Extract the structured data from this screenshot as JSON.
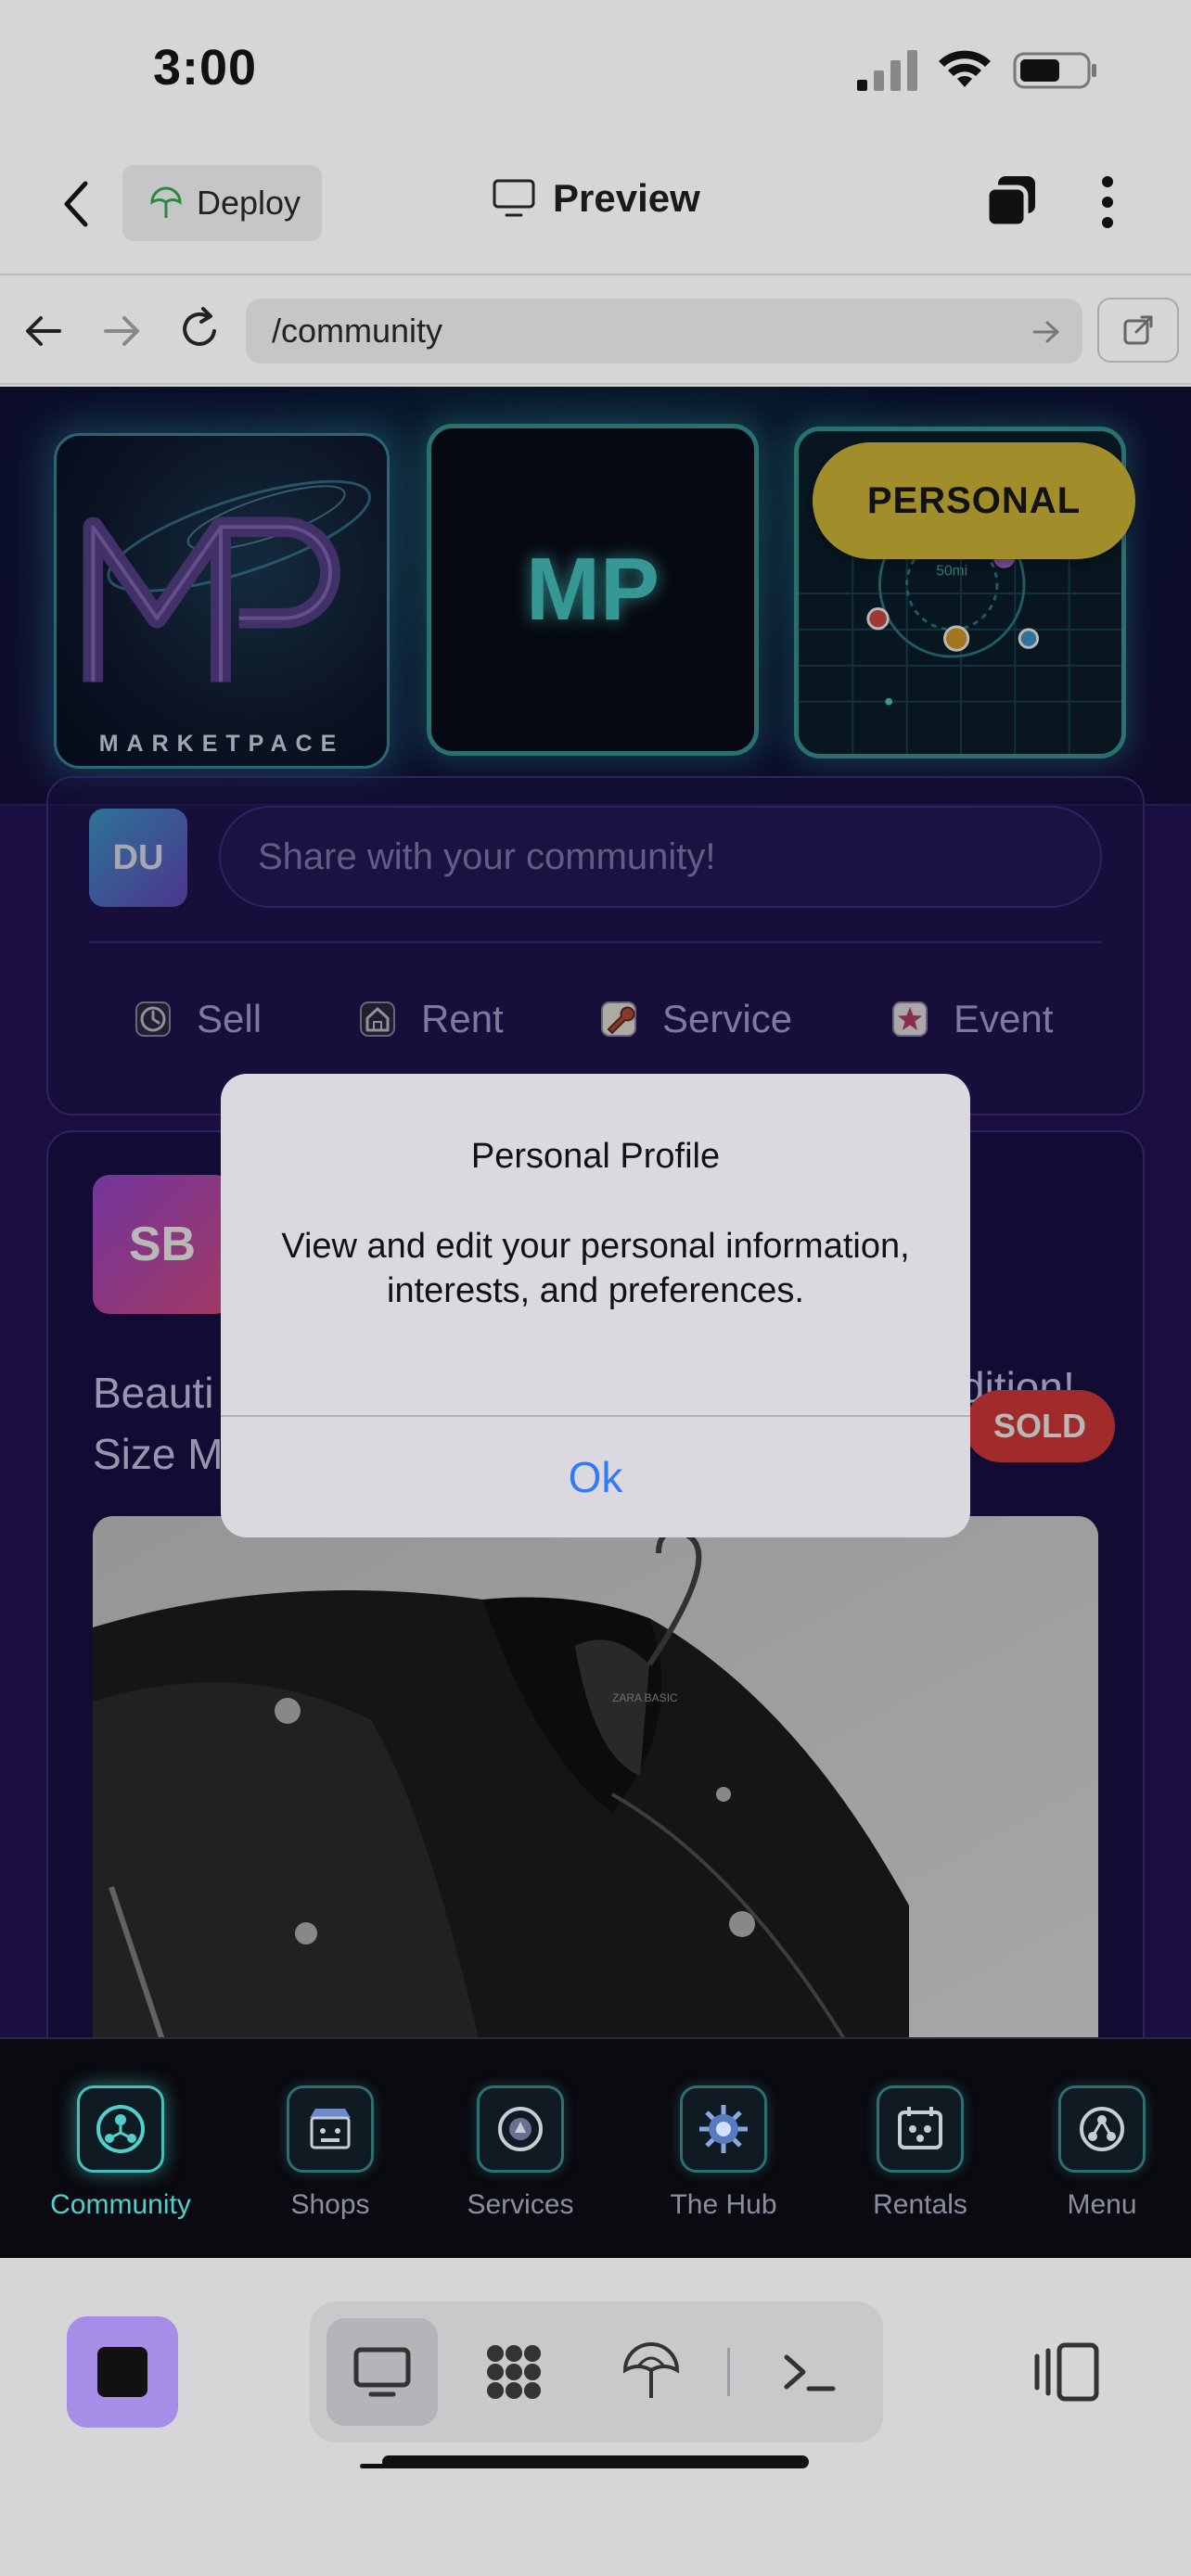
{
  "status_bar": {
    "time": "3:00"
  },
  "header": {
    "deploy_label": "Deploy",
    "title": "Preview"
  },
  "url_bar": {
    "path": "/community"
  },
  "hero": {
    "logo_wordmark": "MARKETPACE",
    "mp_tile_label": "MP",
    "personal_label": "PERSONAL",
    "radar_label": "50mi"
  },
  "composer": {
    "avatar_initials": "DU",
    "placeholder": "Share with your community!",
    "actions": [
      {
        "label": "Sell",
        "icon": "clock-icon"
      },
      {
        "label": "Rent",
        "icon": "house-icon"
      },
      {
        "label": "Service",
        "icon": "wrench-icon"
      },
      {
        "label": "Event",
        "icon": "star-icon"
      }
    ]
  },
  "post": {
    "avatar_initials": "SB",
    "title_line1": "Beauti",
    "title_line2": "Size M",
    "title_right": "dition!",
    "badge": "SOLD",
    "image_label": "ZARA BASIC"
  },
  "alert": {
    "title": "Personal Profile",
    "message": "View and edit your personal information, interests, and preferences.",
    "ok_label": "Ok"
  },
  "app_tabs": [
    {
      "label": "Community",
      "active": true
    },
    {
      "label": "Shops",
      "active": false
    },
    {
      "label": "Services",
      "active": false
    },
    {
      "label": "The Hub",
      "active": false
    },
    {
      "label": "Rentals",
      "active": false
    },
    {
      "label": "Menu",
      "active": false
    }
  ],
  "colors": {
    "accent": "#4fd0cc",
    "personal_pill": "#e0c53b",
    "sold": "#e03c3c",
    "ok": "#2f7cf6",
    "stop": "#a58de8"
  }
}
